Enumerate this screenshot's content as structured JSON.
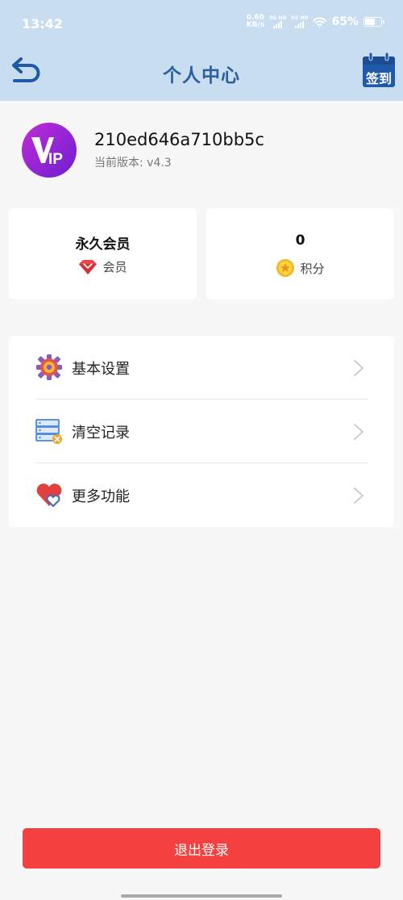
{
  "status_bar": {
    "time": "13:42",
    "net_speed_value": "0.60",
    "net_speed_unit": "KB/s",
    "sim1_label": "5G HD",
    "sim2_label": "5G HD",
    "battery_percent": "65%",
    "battery_level": 0.65
  },
  "header": {
    "title": "个人中心",
    "back_icon": "undo-arrow-icon",
    "signin_label": "签到",
    "signin_icon": "calendar-icon"
  },
  "profile": {
    "avatar_text": "IP",
    "username": "210ed646a710bb5c",
    "version": "当前版本: v4.3"
  },
  "stats": {
    "membership_value": "永久会员",
    "membership_label": "会员",
    "membership_icon": "ruby-gem-icon",
    "points_value": "0",
    "points_label": "积分",
    "points_icon": "star-coin-icon"
  },
  "menu": {
    "items": [
      {
        "label": "基本设置",
        "icon": "gear-icon"
      },
      {
        "label": "清空记录",
        "icon": "server-clear-icon"
      },
      {
        "label": "更多功能",
        "icon": "heart-icon"
      }
    ]
  },
  "logout": {
    "label": "退出登录"
  },
  "colors": {
    "header_bg": "#c8ddf0",
    "title": "#2b5f9e",
    "logout": "#f54040",
    "page_bg": "#f7f7f7"
  }
}
